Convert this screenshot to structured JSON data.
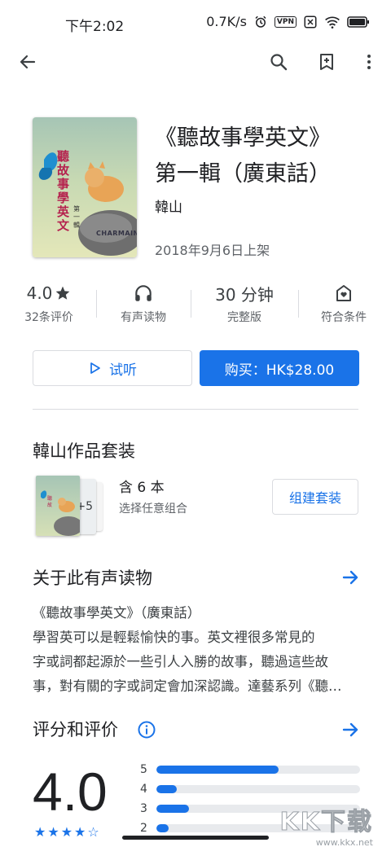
{
  "status": {
    "time": "下午2:02",
    "speed": "0.7K/s",
    "vpn": "VPN",
    "battery": "93"
  },
  "book": {
    "title_line1": "《聽故事學英文》",
    "title_line2": "第一輯（廣東話）",
    "author": "韓山",
    "date": "2018年9月6日上架",
    "cover": {
      "title": "聽故事學英文",
      "volume": "第一輯",
      "brand": "CHARMAINE"
    }
  },
  "stats": {
    "rating": "4.0",
    "rating_label": "32条评价",
    "audio_label": "有声读物",
    "duration": "30 分钟",
    "duration_label": "完整版",
    "eligible_label": "符合条件"
  },
  "actions": {
    "preview": "试听",
    "buy": "购买：HK$28.00"
  },
  "bundle": {
    "title": "韓山作品套装",
    "count": "含 6 本",
    "subtitle": "选择任意组合",
    "more": "+5",
    "button": "组建套装"
  },
  "about": {
    "title": "关于此有声读物",
    "lines": [
      "《聽故事學英文》（廣東話）",
      "學習英可以是輕鬆愉快的事。英文裡很多常見的",
      "字或詞都起源於一些引人入勝的故事，聽過這些故",
      "事，對有關的字或詞定會加深認識。達藝系列《聽…"
    ]
  },
  "ratings": {
    "title": "评分和评价",
    "score": "4.0",
    "stars": "★★★★☆",
    "bars": [
      {
        "label": "5",
        "fraction": 0.6
      },
      {
        "label": "4",
        "fraction": 0.1
      },
      {
        "label": "3",
        "fraction": 0.16
      },
      {
        "label": "2",
        "fraction": 0.06
      }
    ]
  },
  "watermark": {
    "text": "KK下载",
    "url": "www.kkx.net"
  },
  "colors": {
    "accent": "#1a73e8",
    "text": "#202124",
    "secondary": "#5f6368"
  }
}
